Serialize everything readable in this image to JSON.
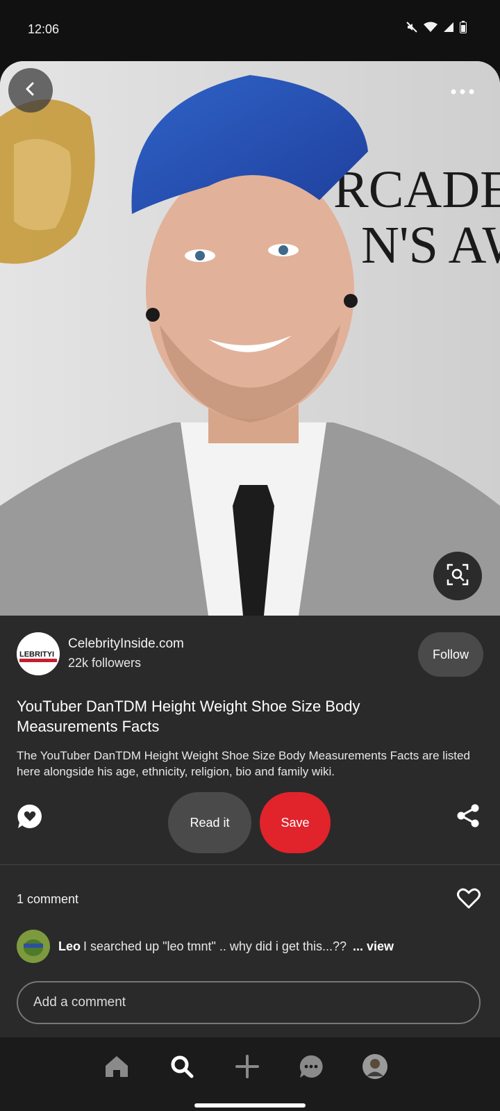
{
  "status_bar": {
    "time": "12:06",
    "icons": [
      "mute-icon",
      "wifi-icon",
      "signal-icon",
      "battery-icon"
    ]
  },
  "pin": {
    "image_actions": {
      "back": "chevron-left-icon",
      "more": "more-options-icon",
      "visual_search": "lens-search-icon"
    },
    "source": {
      "name": "CelebrityInside.com",
      "followers": "22k followers",
      "follow_label": "Follow",
      "logo_text": "LEBRITYI"
    },
    "title": "YouTuber DanTDM Height Weight Shoe Size Body Measurements Facts",
    "description": "The YouTuber DanTDM Height Weight Shoe Size Body Measurements Facts are listed here alongside his age, ethnicity, religion, bio and family wiki.",
    "actions": {
      "read_label": "Read it",
      "save_label": "Save"
    },
    "comments": {
      "count_label": "1 comment",
      "items": [
        {
          "user": "Leo",
          "text": "I searched up \"leo tmnt\" .. why did i get this...??",
          "more": "... view"
        }
      ],
      "placeholder": "Add a comment"
    }
  },
  "nav": {
    "items": [
      "home-icon",
      "search-icon",
      "create-icon",
      "messages-icon",
      "profile-avatar"
    ]
  },
  "colors": {
    "save_red": "#e1232b",
    "panel_bg": "#2a2a2a",
    "status_bg": "#111111",
    "nav_bg": "#1b1b1b"
  }
}
